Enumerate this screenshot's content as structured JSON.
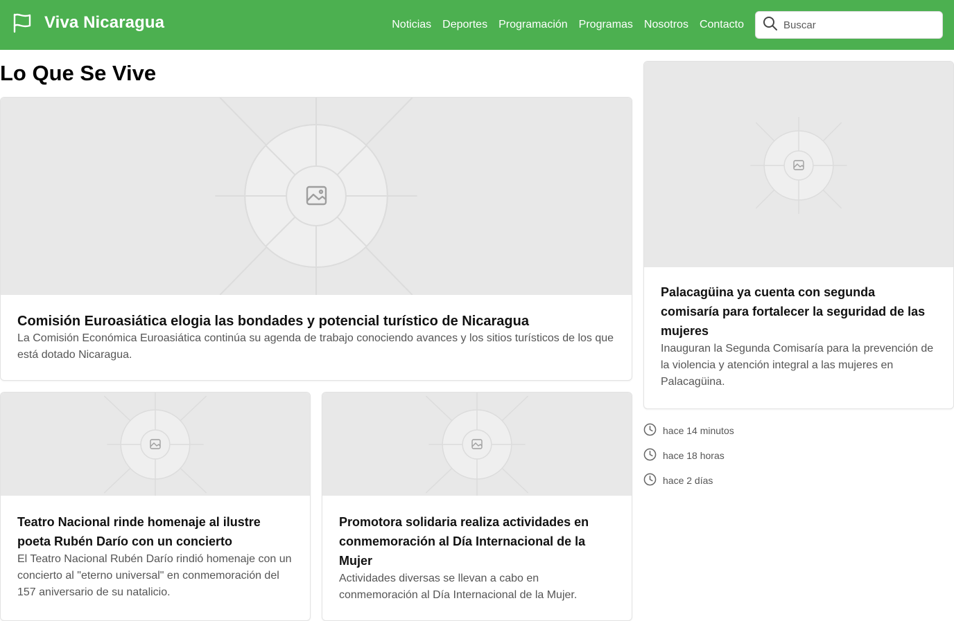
{
  "header": {
    "brand": "Viva Nicaragua",
    "nav": [
      "Noticias",
      "Deportes",
      "Programación",
      "Programas",
      "Nosotros",
      "Contacto"
    ],
    "search_placeholder": "Buscar"
  },
  "colors": {
    "brand_green": "#4cb050",
    "placeholder_bg": "#e8e8e8"
  },
  "section_title": "Lo Que Se Vive",
  "articles": {
    "main": {
      "title": "Comisión Euroasiática elogia las bondades y potencial turístico de Nicaragua",
      "summary": "La Comisión Económica Euroasiática continúa su agenda de trabajo conociendo avances y los sitios turísticos de los que está dotado Nicaragua."
    },
    "side": {
      "title": "Palacagüina ya cuenta con segunda comisaría para fortalecer la seguridad de las mujeres",
      "summary": "Inauguran la Segunda Comisaría para la prevención de la violencia y atención integral a las mujeres en Palacagüina."
    },
    "left": {
      "title": "Teatro Nacional rinde homenaje al ilustre poeta Rubén Darío con un concierto",
      "summary": "El Teatro Nacional Rubén Darío rindió homenaje con un concierto al \"eterno universal\" en conmemoración del 157 aniversario de su natalicio."
    },
    "right": {
      "title": "Promotora solidaria realiza actividades en conmemoración al Día Internacional de la Mujer",
      "summary": "Actividades diversas se llevan a cabo en conmemoración al Día Internacional de la Mujer."
    }
  },
  "timestamps": [
    "hace 14 minutos",
    "hace 18 horas",
    "hace 2 días"
  ],
  "icons": {
    "brand": "flag-icon",
    "search": "search-icon",
    "clock": "clock-icon",
    "placeholder": "image-placeholder-icon"
  }
}
